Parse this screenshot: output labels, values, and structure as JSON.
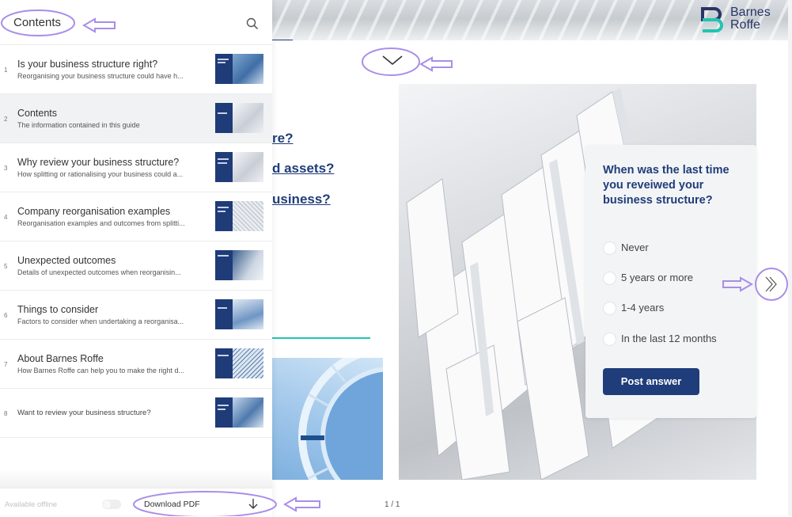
{
  "brand": {
    "line1": "Barnes",
    "line2": "Roffe"
  },
  "sidebar": {
    "title": "Contents",
    "items": [
      {
        "num": "1",
        "title": "Is your business structure right?",
        "desc": "Reorganising your business structure could have h..."
      },
      {
        "num": "2",
        "title": "Contents",
        "desc": "The information contained in this guide"
      },
      {
        "num": "3",
        "title": "Why review your business structure?",
        "desc": "How splitting or rationalising your business could a..."
      },
      {
        "num": "4",
        "title": "Company reorganisation examples",
        "desc": "Reorganisation examples and outcomes from splitti..."
      },
      {
        "num": "5",
        "title": "Unexpected outcomes",
        "desc": "Details of unexpected outcomes when reorganisin..."
      },
      {
        "num": "6",
        "title": "Things to consider",
        "desc": "Factors to consider when undertaking a reorganisa..."
      },
      {
        "num": "7",
        "title": "About Barnes Roffe",
        "desc": "How Barnes Roffe can help you to make the right d..."
      },
      {
        "num": "8",
        "title": "Want to review your business structure?",
        "desc": ""
      }
    ],
    "footer": {
      "offline_label": "Available offline",
      "download_label": "Download PDF"
    }
  },
  "doc": {
    "links": [
      "re?",
      "d assets?",
      "usiness?"
    ],
    "page_indicator": "1 / 1"
  },
  "poll": {
    "question": "When was the last time you reveiwed your business structure?",
    "options": [
      "Never",
      "5 years or more",
      "1-4 years",
      "In the last 12 months"
    ],
    "submit_label": "Post answer"
  },
  "colors": {
    "navy": "#1f3d7a",
    "teal": "#22c4b1",
    "annotation": "#a98ee8"
  }
}
